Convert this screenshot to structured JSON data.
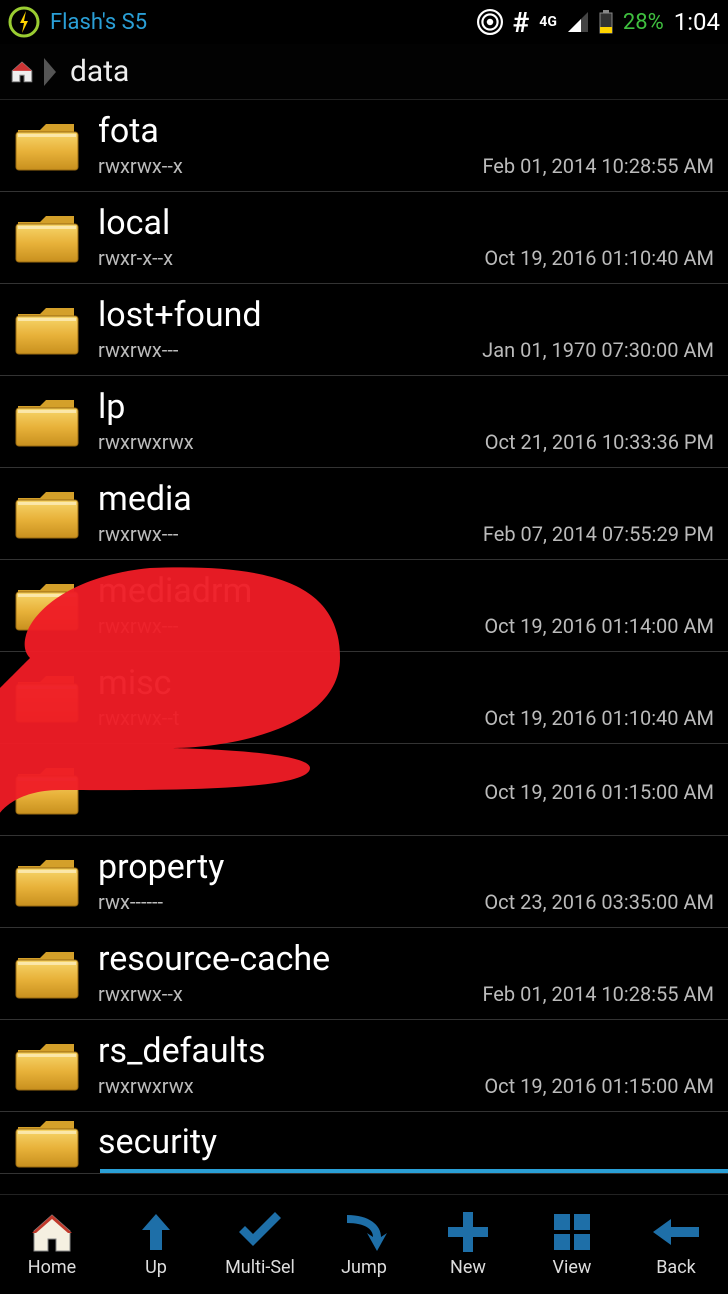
{
  "status": {
    "device": "Flash's S5",
    "net": "4G",
    "battery": "28%",
    "time": "1:04"
  },
  "breadcrumb": {
    "path": "data"
  },
  "folders": [
    {
      "name": "fota",
      "perm": "rwxrwx--x",
      "date": "Feb 01, 2014 10:28:55 AM"
    },
    {
      "name": "local",
      "perm": "rwxr-x--x",
      "date": "Oct 19, 2016 01:10:40 AM"
    },
    {
      "name": "lost+found",
      "perm": "rwxrwx---",
      "date": "Jan 01, 1970 07:30:00 AM"
    },
    {
      "name": "lp",
      "perm": "rwxrwxrwx",
      "date": "Oct 21, 2016 10:33:36 PM"
    },
    {
      "name": "media",
      "perm": "rwxrwx---",
      "date": "Feb 07, 2014 07:55:29 PM"
    },
    {
      "name": "mediadrm",
      "perm": "rwxrwx---",
      "date": "Oct 19, 2016 01:14:00 AM"
    },
    {
      "name": "misc",
      "perm": "rwxrwx--t",
      "date": "Oct 19, 2016 01:10:40 AM"
    },
    {
      "name": "",
      "perm": "",
      "date": "Oct 19, 2016 01:15:00 AM"
    },
    {
      "name": "property",
      "perm": "rwx------",
      "date": "Oct 23, 2016 03:35:00 AM"
    },
    {
      "name": "resource-cache",
      "perm": "rwxrwx--x",
      "date": "Feb 01, 2014 10:28:55 AM"
    },
    {
      "name": "rs_defaults",
      "perm": "rwxrwxrwx",
      "date": "Oct 19, 2016 01:15:00 AM"
    },
    {
      "name": "security",
      "perm": "",
      "date": ""
    }
  ],
  "toolbar": {
    "home": "Home",
    "up": "Up",
    "multisel": "Multi-Sel",
    "jump": "Jump",
    "new": "New",
    "view": "View",
    "back": "Back"
  }
}
